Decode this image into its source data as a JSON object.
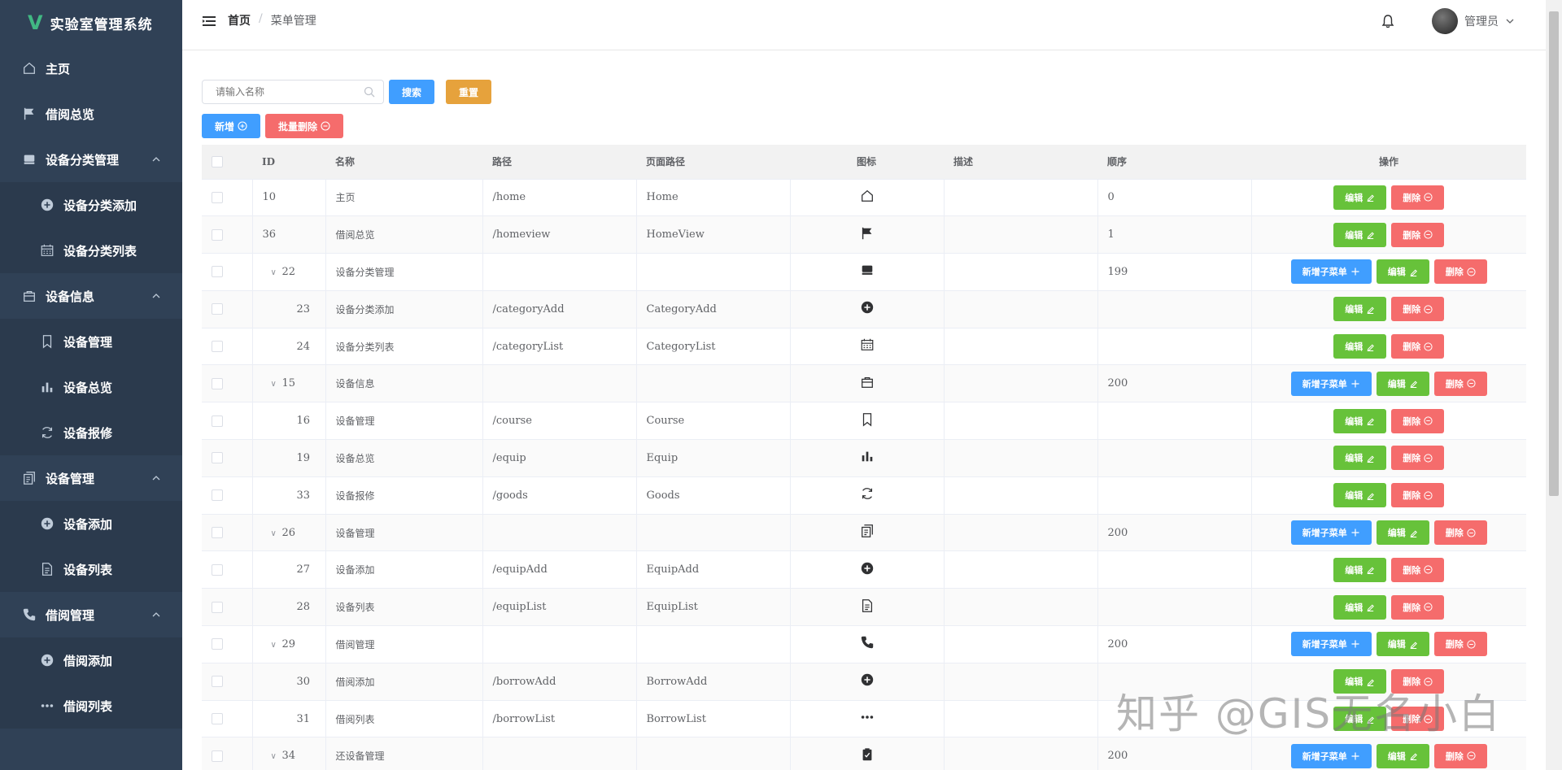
{
  "app": {
    "title": "实验室管理系统",
    "logo_letter": "V"
  },
  "sidebar": {
    "items": [
      {
        "label": "主页",
        "icon": "home-icon",
        "type": "item"
      },
      {
        "label": "借阅总览",
        "icon": "flag-icon",
        "type": "item"
      },
      {
        "label": "设备分类管理",
        "icon": "box-icon",
        "type": "group"
      },
      {
        "label": "设备分类添加",
        "icon": "plus-circle-icon",
        "type": "sub"
      },
      {
        "label": "设备分类列表",
        "icon": "calendar-icon",
        "type": "sub"
      },
      {
        "label": "设备信息",
        "icon": "bag-icon",
        "type": "group"
      },
      {
        "label": "设备管理",
        "icon": "bookmark-icon",
        "type": "sub"
      },
      {
        "label": "设备总览",
        "icon": "bar-chart-icon",
        "type": "sub"
      },
      {
        "label": "设备报修",
        "icon": "refresh-icon",
        "type": "sub"
      },
      {
        "label": "设备管理",
        "icon": "document-copy-icon",
        "type": "group"
      },
      {
        "label": "设备添加",
        "icon": "plus-circle-icon",
        "type": "sub"
      },
      {
        "label": "设备列表",
        "icon": "document-icon",
        "type": "sub"
      },
      {
        "label": "借阅管理",
        "icon": "phone-icon",
        "type": "group"
      },
      {
        "label": "借阅添加",
        "icon": "plus-circle-icon",
        "type": "sub"
      },
      {
        "label": "借阅列表",
        "icon": "more-icon",
        "type": "sub"
      }
    ]
  },
  "header": {
    "breadcrumb_home": "首页",
    "breadcrumb_sep": "/",
    "breadcrumb_current": "菜单管理",
    "user_name": "管理员"
  },
  "toolbar": {
    "search_placeholder": "请输入名称",
    "search_label": "搜索",
    "reset_label": "重置",
    "add_label": "新增",
    "batch_delete_label": "批量删除"
  },
  "table": {
    "headers": [
      "ID",
      "名称",
      "路径",
      "页面路径",
      "图标",
      "描述",
      "顺序",
      "操作"
    ],
    "add_child_label": "新增子菜单",
    "edit_label": "编辑",
    "delete_label": "删除",
    "rows": [
      {
        "id": "10",
        "name": "主页",
        "path": "/home",
        "page": "Home",
        "icon": "home-icon",
        "desc": "",
        "order": "0",
        "level": "leaf"
      },
      {
        "id": "36",
        "name": "借阅总览",
        "path": "/homeview",
        "page": "HomeView",
        "icon": "flag-icon",
        "desc": "",
        "order": "1",
        "level": "leaf"
      },
      {
        "id": "22",
        "name": "设备分类管理",
        "path": "",
        "page": "",
        "icon": "box-icon",
        "desc": "",
        "order": "199",
        "level": "parent"
      },
      {
        "id": "23",
        "name": "设备分类添加",
        "path": "/categoryAdd",
        "page": "CategoryAdd",
        "icon": "plus-circle-icon",
        "desc": "",
        "order": "",
        "level": "child"
      },
      {
        "id": "24",
        "name": "设备分类列表",
        "path": "/categoryList",
        "page": "CategoryList",
        "icon": "calendar-icon",
        "desc": "",
        "order": "",
        "level": "child"
      },
      {
        "id": "15",
        "name": "设备信息",
        "path": "",
        "page": "",
        "icon": "bag-icon",
        "desc": "",
        "order": "200",
        "level": "parent"
      },
      {
        "id": "16",
        "name": "设备管理",
        "path": "/course",
        "page": "Course",
        "icon": "bookmark-icon",
        "desc": "",
        "order": "",
        "level": "child"
      },
      {
        "id": "19",
        "name": "设备总览",
        "path": "/equip",
        "page": "Equip",
        "icon": "bar-chart-icon",
        "desc": "",
        "order": "",
        "level": "child"
      },
      {
        "id": "33",
        "name": "设备报修",
        "path": "/goods",
        "page": "Goods",
        "icon": "refresh-icon",
        "desc": "",
        "order": "",
        "level": "child"
      },
      {
        "id": "26",
        "name": "设备管理",
        "path": "",
        "page": "",
        "icon": "document-copy-icon",
        "desc": "",
        "order": "200",
        "level": "parent"
      },
      {
        "id": "27",
        "name": "设备添加",
        "path": "/equipAdd",
        "page": "EquipAdd",
        "icon": "plus-circle-icon",
        "desc": "",
        "order": "",
        "level": "child"
      },
      {
        "id": "28",
        "name": "设备列表",
        "path": "/equipList",
        "page": "EquipList",
        "icon": "document-icon",
        "desc": "",
        "order": "",
        "level": "child"
      },
      {
        "id": "29",
        "name": "借阅管理",
        "path": "",
        "page": "",
        "icon": "phone-icon",
        "desc": "",
        "order": "200",
        "level": "parent"
      },
      {
        "id": "30",
        "name": "借阅添加",
        "path": "/borrowAdd",
        "page": "BorrowAdd",
        "icon": "plus-circle-icon",
        "desc": "",
        "order": "",
        "level": "child"
      },
      {
        "id": "31",
        "name": "借阅列表",
        "path": "/borrowList",
        "page": "BorrowList",
        "icon": "more-icon",
        "desc": "",
        "order": "",
        "level": "child"
      },
      {
        "id": "34",
        "name": "还设备管理",
        "path": "",
        "page": "",
        "icon": "clipboard-icon",
        "desc": "",
        "order": "200",
        "level": "parent"
      }
    ]
  },
  "watermark": "知乎 @GIS无名小白",
  "colors": {
    "sidebar_bg": "#304156",
    "primary": "#409eff",
    "success": "#67c23a",
    "danger": "#f56c6c",
    "warning": "#e6a23c"
  }
}
